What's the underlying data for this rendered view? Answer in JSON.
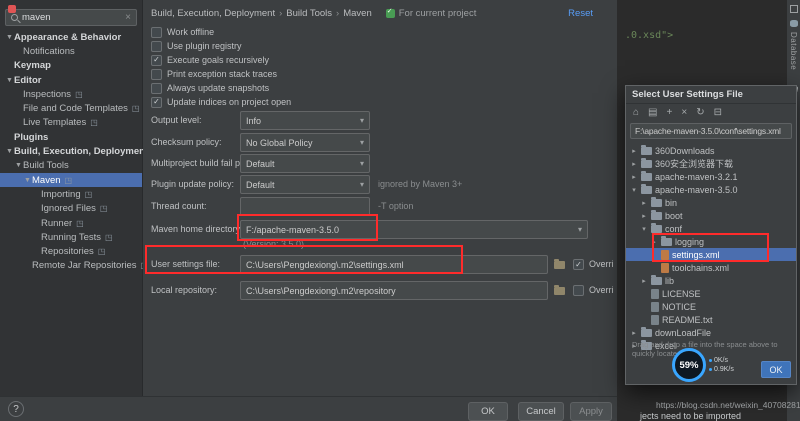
{
  "colors": {
    "accent_blue": "#4b6eaf",
    "link_blue": "#589df6",
    "annotation_red": "#ff2b2b",
    "code_green": "#6a8759"
  },
  "sidebar": {
    "search": {
      "value": "maven",
      "clear_icon": "×"
    },
    "items": [
      {
        "label": "Appearance & Behavior",
        "level": 0,
        "bold": true,
        "arrow": "expanded"
      },
      {
        "label": "Notifications",
        "level": 1
      },
      {
        "label": "Keymap",
        "level": 0,
        "bold": true
      },
      {
        "label": "Editor",
        "level": 0,
        "bold": true,
        "arrow": "expanded"
      },
      {
        "label": "Inspections",
        "level": 1,
        "badge": true
      },
      {
        "label": "File and Code Templates",
        "level": 1,
        "badge": true
      },
      {
        "label": "Live Templates",
        "level": 1,
        "badge": true
      },
      {
        "label": "Plugins",
        "level": 0,
        "bold": true
      },
      {
        "label": "Build, Execution, Deployment",
        "level": 0,
        "bold": true,
        "arrow": "expanded"
      },
      {
        "label": "Build Tools",
        "level": 1,
        "arrow": "expanded"
      },
      {
        "label": "Maven",
        "level": 2,
        "arrow": "expanded",
        "selected": true,
        "badge": true
      },
      {
        "label": "Importing",
        "level": 3,
        "badge": true
      },
      {
        "label": "Ignored Files",
        "level": 3,
        "badge": true
      },
      {
        "label": "Runner",
        "level": 3,
        "badge": true
      },
      {
        "label": "Running Tests",
        "level": 3,
        "badge": true
      },
      {
        "label": "Repositories",
        "level": 3,
        "badge": true
      },
      {
        "label": "Remote Jar Repositories",
        "level": 2,
        "badge": true
      }
    ]
  },
  "main": {
    "breadcrumb": [
      "Build, Execution, Deployment",
      "Build Tools",
      "Maven"
    ],
    "for_current_project": "For current project",
    "reset": "Reset",
    "checkboxes": [
      {
        "label": "Work offline",
        "checked": false
      },
      {
        "label": "Use plugin registry",
        "checked": false
      },
      {
        "label": "Execute goals recursively",
        "checked": true
      },
      {
        "label": "Print exception stack traces",
        "checked": false
      },
      {
        "label": "Always update snapshots",
        "checked": false
      },
      {
        "label": "Update indices on project open",
        "checked": true
      }
    ],
    "fields": [
      {
        "label": "Output level:",
        "value": "Info",
        "type": "select"
      },
      {
        "label": "Checksum policy:",
        "value": "No Global Policy",
        "type": "select"
      },
      {
        "label": "Multiproject build fail policy:",
        "value": "Default",
        "type": "select"
      },
      {
        "label": "Plugin update policy:",
        "value": "Default",
        "type": "select",
        "note": "ignored by Maven 3+"
      },
      {
        "label": "Thread count:",
        "value": "",
        "type": "text",
        "note": "-T option"
      }
    ],
    "maven_home": {
      "label": "Maven home directory:",
      "value": "F:/apache-maven-3.5.0",
      "version": "(Version: 3.5.0)"
    },
    "user_settings": {
      "label": "User settings file:",
      "value": "C:\\Users\\Pengdexiong\\.m2\\settings.xml",
      "override_label": "Overri",
      "override_checked": true
    },
    "local_repository": {
      "label": "Local repository:",
      "value": "C:\\Users\\Pengdexiong\\.m2\\repository",
      "override_label": "Overri",
      "override_checked": false
    },
    "footer": {
      "help": "?",
      "ok": "OK",
      "cancel": "Cancel",
      "apply": "Apply"
    }
  },
  "editor": {
    "code": ".0.xsd\">",
    "database_label": "Database",
    "maven_tab": "m"
  },
  "file_dialog": {
    "title": "Select User Settings File",
    "toolbar_icons": [
      {
        "name": "home",
        "glyph": "⌂"
      },
      {
        "name": "desktop",
        "glyph": "▤"
      },
      {
        "name": "new-folder",
        "glyph": "+"
      },
      {
        "name": "delete",
        "glyph": "×"
      },
      {
        "name": "refresh",
        "glyph": "↻"
      },
      {
        "name": "hide-path",
        "glyph": "⊟"
      }
    ],
    "path": "F:\\apache-maven-3.5.0\\conf\\settings.xml",
    "tree": [
      {
        "label": "360Downloads",
        "level": 0,
        "type": "folder",
        "arrow": "collapsed"
      },
      {
        "label": "360安全浏览器下载",
        "level": 0,
        "type": "folder",
        "arrow": "collapsed"
      },
      {
        "label": "apache-maven-3.2.1",
        "level": 0,
        "type": "folder",
        "arrow": "collapsed"
      },
      {
        "label": "apache-maven-3.5.0",
        "level": 0,
        "type": "folder",
        "arrow": "expanded"
      },
      {
        "label": "bin",
        "level": 1,
        "type": "folder",
        "arrow": "collapsed"
      },
      {
        "label": "boot",
        "level": 1,
        "type": "folder",
        "arrow": "collapsed"
      },
      {
        "label": "conf",
        "level": 1,
        "type": "folder",
        "arrow": "expanded"
      },
      {
        "label": "logging",
        "level": 2,
        "type": "folder",
        "arrow": "collapsed"
      },
      {
        "label": "settings.xml",
        "level": 2,
        "type": "xml",
        "selected": true
      },
      {
        "label": "toolchains.xml",
        "level": 2,
        "type": "xml"
      },
      {
        "label": "lib",
        "level": 1,
        "type": "folder",
        "arrow": "collapsed"
      },
      {
        "label": "LICENSE",
        "level": 1,
        "type": "file"
      },
      {
        "label": "NOTICE",
        "level": 1,
        "type": "file"
      },
      {
        "label": "README.txt",
        "level": 1,
        "type": "file"
      },
      {
        "label": "downLoadFile",
        "level": 0,
        "type": "folder",
        "arrow": "collapsed"
      },
      {
        "label": "excel",
        "level": 0,
        "type": "folder",
        "arrow": "collapsed"
      }
    ],
    "hint": "Drag and drop a file into the space above to quickly locate",
    "ok": "OK"
  },
  "net_overlay": {
    "percent": "59%",
    "up": "0K/s",
    "down": "0.9K/s"
  },
  "watermark": "https://blog.csdn.net/weixin_40708281",
  "background_text": "jects need to be imported"
}
